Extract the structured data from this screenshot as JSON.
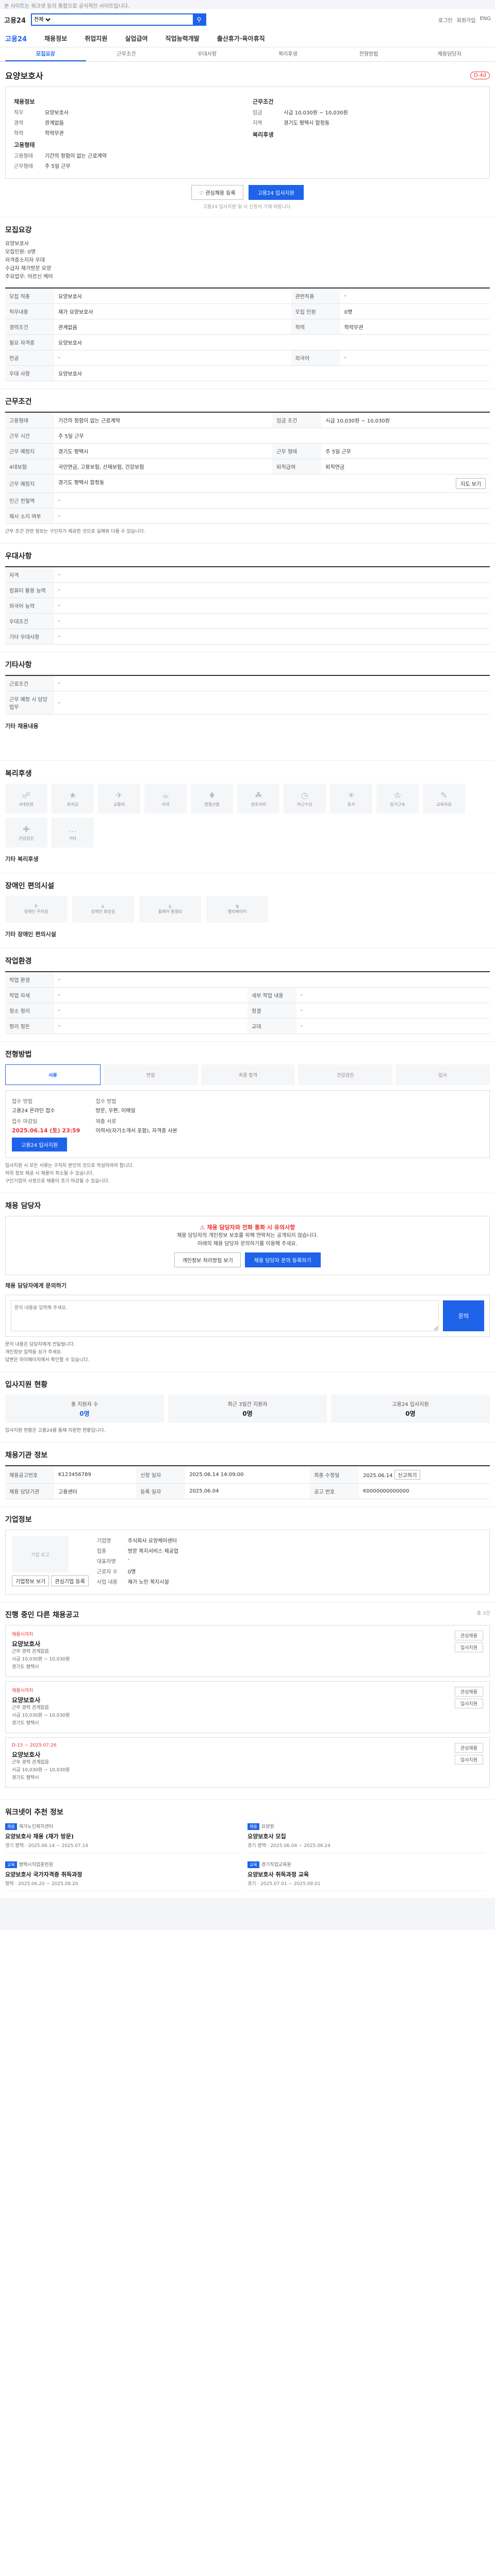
{
  "notice": "본 사이트는 워크넷 등의 통합으로 공식적인 사이트입니다.",
  "header": {
    "logo": "고용24",
    "search_category": "전체",
    "search_placeholder": "",
    "search_value": "",
    "top_links": [
      "로그인",
      "회원가입",
      "ENG"
    ]
  },
  "gnb": [
    "고용24",
    "채용정보",
    "취업지원",
    "실업급여",
    "직업능력개발",
    "출산휴가·육아휴직"
  ],
  "tabs": [
    "모집요강",
    "근무조건",
    "우대사항",
    "복리후생",
    "전형방법",
    "채용담당자"
  ],
  "company": {
    "name": "요양보호사",
    "badge": "D-4d",
    "info_title": "채용정보",
    "recruit_left": [
      {
        "k": "직무",
        "v": "요양보호사"
      },
      {
        "k": "경력",
        "v": "관계없음"
      },
      {
        "k": "학력",
        "v": "학력무관"
      }
    ],
    "condition_title": "근무조건",
    "recruit_right": [
      {
        "k": "임금",
        "v": "시급 10,030원 ~ 10,030원"
      },
      {
        "k": "지역",
        "v": "경기도 평택시 합정동"
      }
    ],
    "employ_form_title": "고용형태",
    "employ_form": [
      {
        "k": "고용형태",
        "v": "기간의 정함이 없는 근로계약"
      },
      {
        "k": "근무형태",
        "v": "주 5일 근무"
      }
    ],
    "welfare_title": "복리후생",
    "scrap_label": "♡ 관심채용 등록",
    "apply_label": "고용24 입사지원",
    "apply_note": "고용24 입사지원 및 시 신청서 기재 바랍니다."
  },
  "recruit_summary": {
    "title": "모집요강",
    "lines": [
      "요양보호사",
      "모집인원: 0명",
      "자격증소지자 우대",
      "수급자 재가방문 요양",
      "주요업무: 어르신 케어"
    ]
  },
  "recruit_table": [
    [
      "모집 직종",
      "요양보호사",
      "관련직종",
      "-"
    ],
    [
      "직무내용",
      "재가 요양보호사",
      "모집 인원",
      "0명"
    ],
    [
      "경력조건",
      "관계없음",
      "학력",
      "학력무관"
    ],
    [
      "필요 자격증",
      "요양보호사",
      "",
      ""
    ],
    [
      "전공",
      "-",
      "외국어",
      "-"
    ],
    [
      "우대 사항",
      "요양보호사",
      "",
      ""
    ]
  ],
  "work_cond": {
    "title": "근무조건",
    "rows": [
      [
        "고용형태",
        "기간의 정함이 없는 근로계약",
        "임금 조건",
        "시급 10,030원 ~ 10,030원"
      ],
      [
        "근무 시간",
        "주 5일 근무",
        "",
        ""
      ],
      [
        "근무 예정지",
        "경기도 평택시",
        "근무 형태",
        "주 5일 근무"
      ],
      [
        "4대보험",
        "국민연금, 고용보험, 산재보험, 건강보험",
        "퇴직급여",
        "퇴직연금"
      ],
      [
        "근무 예정지",
        "경기도 평택시 합정동",
        "",
        ""
      ],
      [
        "인근 전철역",
        "-",
        "",
        ""
      ],
      [
        "제시 소지 여부",
        "-",
        "",
        ""
      ]
    ],
    "map_button": "지도 보기",
    "note": "근무 조건 관련 정보는 구인자가 제공한 것으로 실제와 다를 수 있습니다."
  },
  "prefer": {
    "title": "우대사항",
    "rows": [
      [
        "자격",
        "-"
      ],
      [
        "컴퓨터 활용 능력",
        "-"
      ],
      [
        "외국어 능력",
        "-"
      ],
      [
        "우대조건",
        "-"
      ],
      [
        "기타 우대사항",
        "-"
      ]
    ]
  },
  "etc": {
    "title": "기타사항",
    "rows": [
      [
        "근로조건",
        "-"
      ],
      [
        "근무 예정 시 담당 업무",
        "-"
      ]
    ],
    "extra_title": "기타 채용내용"
  },
  "welfare": {
    "title": "복리후생",
    "items": [
      "4대보험",
      "퇴직금",
      "교통비",
      "식대",
      "명절선물",
      "경조사비",
      "야근수당",
      "휴가",
      "장기근속",
      "교육지원",
      "건강검진",
      "기타"
    ],
    "etc_label": "기타 복리후생"
  },
  "env": {
    "title": "장애인 편의시설",
    "items": [
      "장애인 주차장",
      "장애인 화장실",
      "휠체어 통행로",
      "엘리베이터"
    ],
    "etc_label": "기타 장애인 편의시설"
  },
  "workplace": {
    "title": "작업환경",
    "rows": [
      [
        "작업 환경",
        "-",
        "",
        ""
      ],
      [
        "작업 자세",
        "-",
        "세부 작업 내용",
        "-"
      ],
      [
        "청소 정리",
        "-",
        "청결",
        "-"
      ],
      [
        "정리 정돈",
        "-",
        "교대",
        "-"
      ]
    ]
  },
  "process": {
    "title": "전형방법",
    "steps": [
      "서류",
      "면접",
      "최종 합격",
      "건강검진",
      "입사"
    ],
    "apply_method_label": "접수 방법",
    "apply_method": "고용24 온라인 접수",
    "deadline_label": "접수 마감일",
    "deadline": "2025.06.14 (토) 23:59",
    "submit_label": "접수 방법",
    "submit": "방문, 우편, 이메일",
    "docs_label": "제출 서류",
    "docs": "이력서(자기소개서 포함), 자격증 사본",
    "apply_button": "고용24 입사지원",
    "bullets": [
      "입사지원 시 모든 서류는 구직자 본인의 것으로 작성하여야 합니다.",
      "허위 정보 제공 시 채용이 취소될 수 있습니다.",
      "구인기업의 사정으로 채용이 조기 마감될 수 있습니다."
    ]
  },
  "contact": {
    "title": "채용 담당자",
    "warn": "채용 담당자와 전화 통화 시 유의사항",
    "lines": [
      "채용 담당자의 개인정보 보호를 위해 연락처는 공개되지 않습니다.",
      "아래의 채용 담당자 문의하기를 이용해 주세요."
    ],
    "btn1": "개인정보 처리방침 보기",
    "btn2": "채용 담당자 문의 등록하기",
    "inq_title": "채용 담당자에게 문의하기",
    "inq_placeholder": "문의 내용을 입력해 주세요.",
    "inq_button": "문의",
    "inq_notes": [
      "문의 내용은 담당자에게 전달됩니다.",
      "개인정보 입력을 삼가 주세요.",
      "답변은 마이페이지에서 확인할 수 있습니다."
    ]
  },
  "stats": {
    "title": "입사지원 현황",
    "items": [
      {
        "k": "총 지원자 수",
        "v": "0명"
      },
      {
        "k": "최근 3일간 지원자",
        "v": "0명"
      },
      {
        "k": "고용24 입사지원",
        "v": "0명"
      }
    ],
    "note": "입사지원 현황은 고용24를 통해 지원한 현황입니다."
  },
  "recruit_info": {
    "title": "채용기관 정보",
    "rows": [
      [
        "채용공고번호",
        "K123456789",
        "신청 일자",
        "2025.06.14 14:09:00",
        "최종 수정일",
        "2025.06.14"
      ],
      [
        "채용 담당기관",
        "고용센터",
        "등록 일자",
        "2025.06.04",
        "공고 번호",
        "K0000000000000"
      ]
    ],
    "button": "신고하기"
  },
  "corp_info": {
    "title": "기업정보",
    "logo": "기업 로고",
    "rows": [
      [
        "기업명",
        "주식회사 요양케어센터"
      ],
      [
        "업종",
        "방문 복지서비스 제공업"
      ],
      [
        "대표자명",
        "-"
      ],
      [
        "근로자 수",
        "0명"
      ],
      [
        "사업 내용",
        "재가 노인 복지시설"
      ]
    ],
    "btn1": "기업정보 보기",
    "btn2": "관심기업 등록"
  },
  "other_jobs": {
    "title": "진행 중인 다른 채용공고",
    "count_note": "총 3건",
    "items": [
      {
        "tag": "채용시까지",
        "title": "요양보호사",
        "meta": [
          "근무 경력 관계없음",
          "시급 10,030원 ~ 10,030원",
          "경기도 평택시"
        ]
      },
      {
        "tag": "채용시까지",
        "title": "요양보호사",
        "meta": [
          "근무 경력 관계없음",
          "시급 10,030원 ~ 10,030원",
          "경기도 평택시"
        ]
      },
      {
        "tag": "D-15 ~ 2025.07.26",
        "title": "요양보호사",
        "meta": [
          "근무 경력 관계없음",
          "시급 10,030원 ~ 10,030원",
          "경기도 평택시"
        ]
      }
    ],
    "act1": "관심채용",
    "act2": "입사지원"
  },
  "recommend": {
    "title": "워크넷이 추천 정보",
    "items": [
      {
        "lbl": "채용",
        "org": "재가노인복지센터",
        "title": "요양보호사 채용 (재가 방문)",
        "meta": "경기 평택 · 2025.06.14 ~ 2025.07.14"
      },
      {
        "lbl": "채용",
        "org": "요양원",
        "title": "요양보호사 모집",
        "meta": "경기 평택 · 2025.06.04 ~ 2025.06.24"
      },
      {
        "lbl": "교육",
        "org": "평택시직업훈련원",
        "title": "요양보호사 국가자격증 취득과정",
        "meta": "평택 · 2025.06.20 ~ 2025.08.20"
      },
      {
        "lbl": "교육",
        "org": "경기직업교육원",
        "title": "요양보호사 취득과정 교육",
        "meta": "경기 · 2025.07.01 ~ 2025.09.01"
      }
    ]
  }
}
